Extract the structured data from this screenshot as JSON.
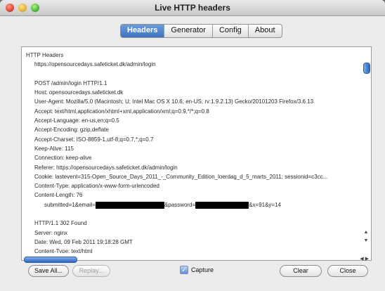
{
  "window": {
    "title": "Live HTTP headers"
  },
  "tabs": [
    {
      "label": "Headers",
      "active": true
    },
    {
      "label": "Generator",
      "active": false
    },
    {
      "label": "Config",
      "active": false
    },
    {
      "label": "About",
      "active": false
    }
  ],
  "content": {
    "lines": [
      "HTTP Headers",
      "https://opensourcedays.safeticket.dk/admin/login",
      "",
      "POST /admin/login HTTP/1.1",
      "Host: opensourcedays.safeticket.dk",
      "User-Agent: Mozilla/5.0 (Macintosh; U; Intel Mac OS X 10.6; en-US; rv:1.9.2.13) Gecko/20101203 Firefox/3.6.13",
      "Accept: text/html,application/xhtml+xml,application/xml;q=0.9,*/*;q=0.8",
      "Accept-Language: en-us,en;q=0.5",
      "Accept-Encoding: gzip,deflate",
      "Accept-Charset: ISO-8859-1,utf-8;q=0.7,*;q=0.7",
      "Keep-Alive: 115",
      "Connection: keep-alive",
      "Referer: https://opensourcedays.safeticket.dk/admin/login",
      "Cookie: lastevent=315-Open_Source_Days_2011_-_Community_Edition_loerdag_d_5_marts_2011; sessionid=c3cc...",
      "Content-Type: application/x-www-form-urlencoded",
      "Content-Length: 76"
    ],
    "post_data": {
      "prefix": "submitted=1&email=",
      "middle": "&password=",
      "suffix": "&x=91&y=14"
    },
    "response_lines": [
      "",
      "HTTP/1.1 302 Found",
      "Server: nginx",
      "Date: Wed, 09 Feb 2011 19:18:28 GMT",
      "Content-Type: text/html"
    ]
  },
  "buttons": {
    "save_all": "Save All...",
    "replay": "Replay...",
    "capture_label": "Capture",
    "clear": "Clear",
    "close": "Close"
  },
  "scroll_arrows": {
    "up": "▲",
    "down": "▼",
    "left": "◀",
    "right": "▶"
  }
}
